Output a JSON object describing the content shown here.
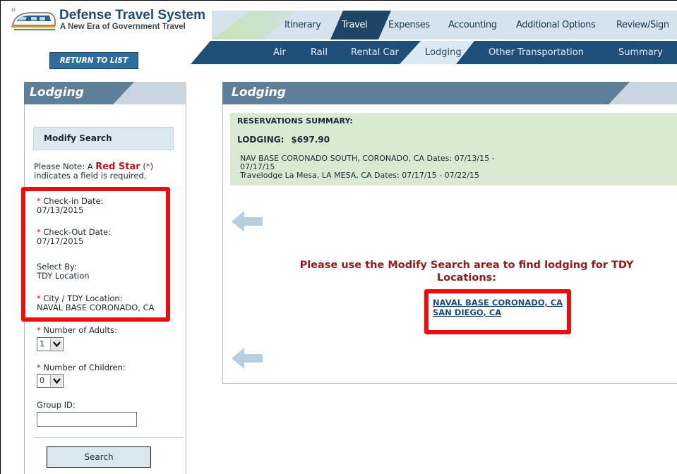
{
  "logo": {
    "title": "Defense Travel System",
    "subtitle": "A New Era of Government Travel"
  },
  "return_button": "RETURN TO LIST",
  "nav": {
    "tabs": [
      "Itinerary",
      "Travel",
      "Expenses",
      "Accounting",
      "Additional Options",
      "Review/Sign"
    ],
    "active_tab": "Travel",
    "subtabs": [
      "Air",
      "Rail",
      "Rental Car",
      "Lodging",
      "Other Transportation",
      "Summary"
    ],
    "active_subtab": "Lodging"
  },
  "left_panel": {
    "title": "Lodging",
    "modify_search": "Modify Search",
    "note": {
      "prefix": "Please Note: A ",
      "red_star": "Red Star",
      "paren_open": " (",
      "star": "*",
      "suffix": ") indicates a field is required."
    },
    "star": "*",
    "fields": {
      "checkin_label": "Check-in Date:",
      "checkin_value": "07/13/2015",
      "checkout_label": "Check-Out Date:",
      "checkout_value": "07/17/2015",
      "selectby_label": "Select By:",
      "selectby_value": "TDY Location",
      "city_label": "City / TDY Location:",
      "city_value": "NAVAL BASE CORONADO, CA",
      "adults_label": "Number of Adults:",
      "adults_value": "1",
      "children_label": "Number of Children:",
      "children_value": "0",
      "group_label": "Group ID:",
      "group_value": ""
    },
    "search_button": "Search"
  },
  "main_panel": {
    "title": "Lodging",
    "summary": {
      "title": "RESERVATIONS SUMMARY:",
      "lodging_label": "LODGING:",
      "lodging_amount": "$697.90",
      "items": [
        "NAV BASE CORONADO SOUTH, CORONADO, CA Dates: 07/13/15 -",
        "07/17/15",
        "Travelodge La Mesa, LA MESA, CA Dates: 07/17/15 - 07/22/15"
      ]
    },
    "message": "Please use the Modify Search area to find lodging for TDY Locations:",
    "locations": [
      "NAVAL BASE CORONADO, CA",
      "SAN DIEGO, CA"
    ]
  },
  "colors": {
    "header_bar": "#5f7e98",
    "nav_dark": "#1f4f78",
    "summary_bg": "#d8ebd2",
    "highlight_red": "#ee0d0d",
    "message_red": "#8f1c22"
  }
}
